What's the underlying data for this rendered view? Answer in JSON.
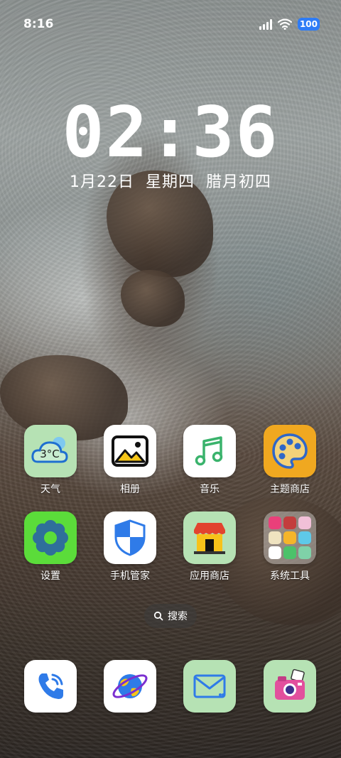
{
  "status_bar": {
    "time": "8:16",
    "battery": "100",
    "signal_icon": "signal-icon",
    "wifi_icon": "wifi-icon"
  },
  "clock": {
    "time": "02:36",
    "date": "1月22日",
    "weekday": "星期四",
    "lunar": "腊月初四"
  },
  "apps": [
    {
      "label": "天气",
      "icon": "weather-icon",
      "text": "3°C",
      "bg": "#b6e2b4"
    },
    {
      "label": "相册",
      "icon": "gallery-icon",
      "bg": "#ffffff"
    },
    {
      "label": "音乐",
      "icon": "music-icon",
      "bg": "#ffffff"
    },
    {
      "label": "主题商店",
      "icon": "palette-icon",
      "bg": "#f0a820"
    },
    {
      "label": "设置",
      "icon": "gear-icon",
      "bg": "#5bdc3a"
    },
    {
      "label": "手机管家",
      "icon": "shield-icon",
      "bg": "#ffffff"
    },
    {
      "label": "应用商店",
      "icon": "store-icon",
      "bg": "#b6e2b4"
    },
    {
      "label": "系统工具",
      "icon": "folder-icon",
      "bg": "rgba(255,255,255,0.35)"
    }
  ],
  "search": {
    "label": "搜索",
    "icon": "search-icon"
  },
  "dock": [
    {
      "icon": "phone-icon",
      "bg": "#ffffff"
    },
    {
      "icon": "browser-icon",
      "bg": "#ffffff"
    },
    {
      "icon": "message-icon",
      "bg": "#b6e2b4"
    },
    {
      "icon": "camera-icon",
      "bg": "#b6e2b4"
    }
  ]
}
